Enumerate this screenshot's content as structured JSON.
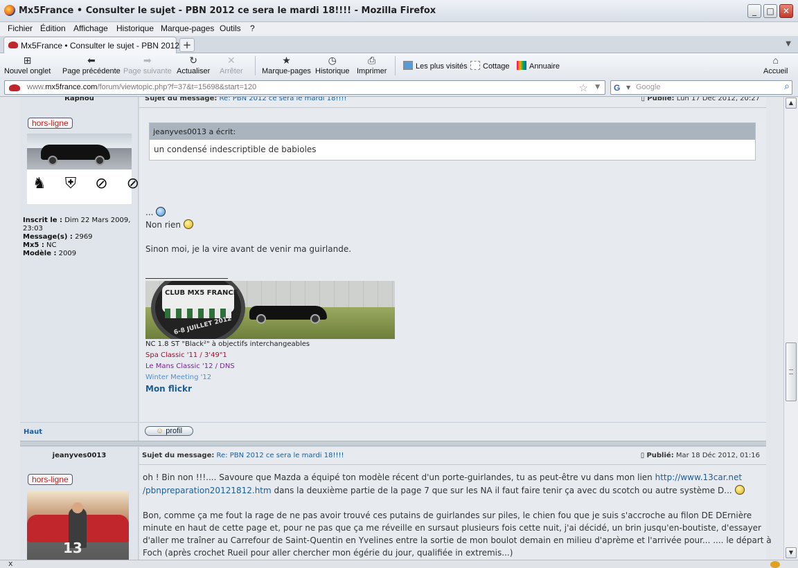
{
  "window": {
    "title": "Mx5France • Consulter le sujet - PBN 2012 ce sera le mardi 18!!!! - Mozilla Firefox",
    "controls": {
      "minimize": "_",
      "maximize": "□",
      "close": "✕"
    }
  },
  "menu": [
    "Fichier",
    "Édition",
    "Affichage",
    "Historique",
    "Marque-pages",
    "Outils",
    "?"
  ],
  "tabs": [
    {
      "label": "Mx5France • Consulter le sujet - PBN 2012 c..."
    }
  ],
  "toolbar": {
    "new_tab": "Nouvel onglet",
    "back": "Page précédente",
    "forward": "Page suivante",
    "reload": "Actualiser",
    "stop": "Arrêter",
    "bookmarks": "Marque-pages",
    "history": "Historique",
    "print": "Imprimer",
    "home": "Accueil"
  },
  "bookmarks_bar": [
    "Les plus visités",
    "Cottage",
    "Annuaire"
  ],
  "address": {
    "url_prefix": "www.",
    "url_domain": "mx5france.com",
    "url_rest": "/forum/viewtopic.php?f=37&t=15698&start=120",
    "search_placeholder": "Google"
  },
  "posts": [
    {
      "author": "Raphou",
      "subject_label": "Sujet du message:",
      "subject": "Re: PBN 2012 ce sera le mardi 18!!!!",
      "posted_label": "Publié:",
      "posted": "Lun 17 Déc 2012, 20:27",
      "status": "hors-ligne",
      "registered_label": "Inscrit le :",
      "registered": "Dim 22 Mars 2009, 23:03",
      "messages_label": "Message(s) :",
      "messages": "2969",
      "mx5_label": "Mx5 :",
      "mx5": "NC",
      "model_label": "Modèle :",
      "model": "2009",
      "quote_author": "jeanyves0013 a écrit:",
      "quote_text": "un condensé indescriptible de babioles",
      "lines": [
        "...",
        "Non rien",
        "Sinon moi, je la vire avant de venir ma guirlande."
      ],
      "signature": {
        "banner_text": "CLUB MX5 FRANCE",
        "banner_date": "6-8 JUILLET 2012",
        "line1": "NC 1.8 ST \"Black²\" à objectifs interchangeables",
        "line2": "Spa Classic '11 / 3'49\"1",
        "line3": "Le Mans Classic '12 / DNS",
        "line4": "Winter Meeting '12",
        "flickr": "Mon flickr"
      },
      "top_link": "Haut",
      "profile_button": "profil"
    },
    {
      "author": "jeanyves0013",
      "subject_label": "Sujet du message:",
      "subject": "Re: PBN 2012 ce sera le mardi 18!!!!",
      "posted_label": "Publié:",
      "posted": "Mar 18 Déc 2012, 01:16",
      "status": "hors-ligne",
      "p1_a": "oh ! Bin non !!!.... Savoure que Mazda a équipé ton modèle récent d'un porte-guirlandes, tu as peut-être vu dans mon lien ",
      "p1_link1": "http://www.13car.net",
      "p1_link2": "/pbnpreparation20121812.htm",
      "p1_b": " dans la deuxième partie de la page 7 que sur les NA il faut faire tenir ça avec du scotch ou autre système D...",
      "p2_l1": "Bon, comme ça me fout la rage de ne pas avoir trouvé ces putains de guirlandes sur piles, le chien fou que je suis s'accroche au filon DE DErnière",
      "p2_l2": "minute en haut de cette page et, pour ne pas que ça me réveille en sursaut plusieurs fois cette nuit, j'ai décidé, un brin jusqu'en-boutiste, d'essayer",
      "p2_l3": "d'aller me traîner au Carrefour de Saint-Quentin en Yvelines entre la sortie de mon boulot demain en milieu d'aprème et l'arrivée pour... .... le départ à",
      "p2_l4": "Foch (après crochet Rueil pour aller chercher mon égérie du jour, qualifiée in extremis...)"
    }
  ],
  "status_bar": {
    "close": "x"
  }
}
